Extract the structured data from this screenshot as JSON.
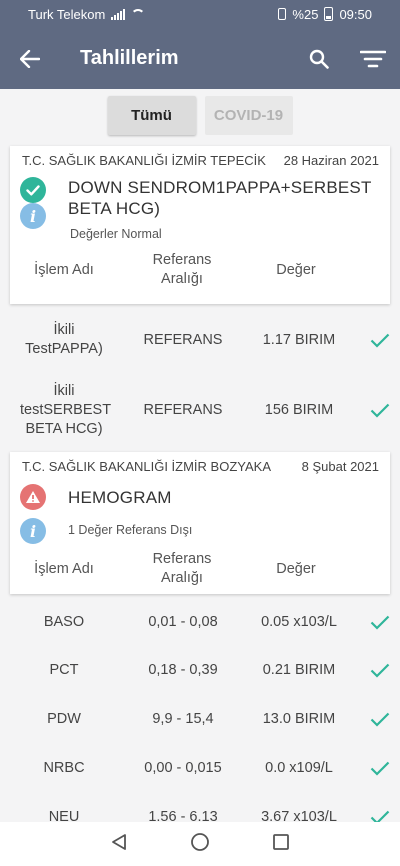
{
  "status_bar": {
    "carrier": "Turk Telekom",
    "battery": "%25",
    "time": "09:50"
  },
  "app_bar": {
    "title": "Tahlillerim"
  },
  "filters": [
    {
      "label": "Tümü",
      "active": true
    },
    {
      "label": "COVID-19",
      "active": false
    }
  ],
  "cards": [
    {
      "hospital": "T.C. SAĞLIK BAKANLIĞI  İZMİR TEPECİK",
      "date": "28 Haziran 2021",
      "status": "ok",
      "test_name": "DOWN SENDROM1PAPPA+SERBEST BETA HCG)",
      "summary": "Değerler Normal",
      "columns": {
        "name": "İşlem Adı",
        "range": "Referans Aralığı",
        "value": "Değer"
      },
      "rows": [
        {
          "name": "İkili TestPAPPA)",
          "range": "REFERANS",
          "value": "1.17 BIRIM"
        },
        {
          "name": "İkili testSERBEST BETA HCG)",
          "range": "REFERANS",
          "value": "156 BIRIM"
        }
      ]
    },
    {
      "hospital": "T.C. SAĞLIK BAKANLIĞI İZMİR BOZYAKA",
      "date": "8 Şubat 2021",
      "status": "warning",
      "test_name": "HEMOGRAM",
      "summary": "1 Değer Referans Dışı",
      "columns": {
        "name": "İşlem Adı",
        "range": "Referans Aralığı",
        "value": "Değer"
      },
      "rows": [
        {
          "name": "BASO",
          "range": "0,01 - 0,08",
          "value": "0.05 x103/L"
        },
        {
          "name": "PCT",
          "range": "0,18 - 0,39",
          "value": "0.21 BIRIM"
        },
        {
          "name": "PDW",
          "range": "9,9 - 15,4",
          "value": "13.0 BIRIM"
        },
        {
          "name": "NRBC",
          "range": "0,00 - 0,015",
          "value": "0.0 x109/L"
        },
        {
          "name": "NEU",
          "range": "1.56 - 6.13",
          "value": "3.67 x103/L"
        }
      ]
    }
  ],
  "colors": {
    "app_bar": "#5f6a82",
    "ok": "#2fb59a",
    "warning": "#e57373",
    "info": "#86bde5",
    "check": "#2fb59a"
  }
}
